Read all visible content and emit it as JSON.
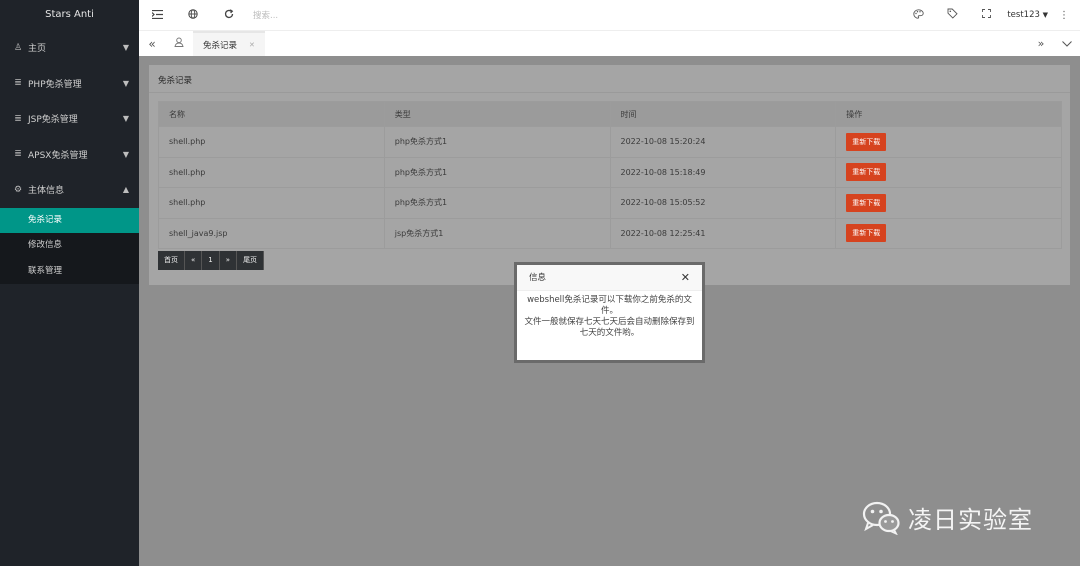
{
  "sidebar": {
    "brand": "Stars Anti",
    "items": [
      {
        "icon": "user-icon",
        "glyph": "♙",
        "label": "主页",
        "caret": "▼"
      },
      {
        "icon": "list-icon",
        "glyph": "≣",
        "label": "PHP免杀管理",
        "caret": "▼"
      },
      {
        "icon": "list-icon",
        "glyph": "≣",
        "label": "JSP免杀管理",
        "caret": "▼"
      },
      {
        "icon": "list-icon",
        "glyph": "≣",
        "label": "APSX免杀管理",
        "caret": "▼"
      },
      {
        "icon": "gear-icon",
        "glyph": "⚙",
        "label": "主体信息",
        "caret": "▲"
      }
    ],
    "sub_items": [
      {
        "label": "免杀记录",
        "active": true
      },
      {
        "label": "修改信息",
        "active": false
      },
      {
        "label": "联系管理",
        "active": false
      }
    ]
  },
  "header": {
    "search_placeholder": "搜索...",
    "user": "test123"
  },
  "tabs": {
    "active_tab": "免杀记录"
  },
  "main": {
    "card_title": "免杀记录",
    "columns": [
      "名称",
      "类型",
      "时间",
      "操作"
    ],
    "rows": [
      {
        "name": "shell.php",
        "type": "php免杀方式1",
        "time": "2022-10-08 15:20:24",
        "action": "重新下载"
      },
      {
        "name": "shell.php",
        "type": "php免杀方式1",
        "time": "2022-10-08 15:18:49",
        "action": "重新下载"
      },
      {
        "name": "shell.php",
        "type": "php免杀方式1",
        "time": "2022-10-08 15:05:52",
        "action": "重新下载"
      },
      {
        "name": "shell_java9.jsp",
        "type": "jsp免杀方式1",
        "time": "2022-10-08 12:25:41",
        "action": "重新下载"
      }
    ],
    "pager": {
      "first": "首页",
      "prev": "«",
      "page": "1",
      "next": "»",
      "last": "尾页"
    }
  },
  "modal": {
    "title": "信息",
    "line1": "webshell免杀记录可以下载你之前免杀的文件。",
    "line2": "文件一般就保存七天七天后会自动删除保存到七天的文件哟。"
  },
  "watermark": {
    "text": "凌日实验室"
  },
  "colors": {
    "sidebar_bg": "#1f2329",
    "active_accent": "#009688",
    "download_button": "#d6431f"
  }
}
